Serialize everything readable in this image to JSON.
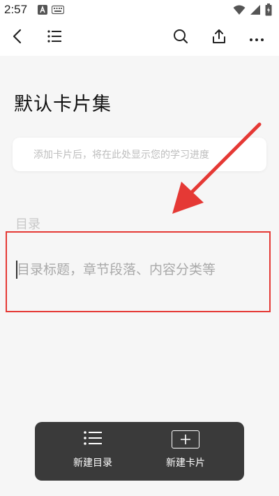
{
  "status_bar": {
    "time": "2:57",
    "icons_left": [
      "a-notification-icon",
      "keyboard-icon"
    ],
    "icons_right": [
      "wifi-icon",
      "signal-icon",
      "battery-icon"
    ]
  },
  "toolbar": {
    "icons": [
      "back-icon",
      "list-icon",
      "search-icon",
      "share-icon",
      "more-icon"
    ]
  },
  "page": {
    "title": "默认卡片集",
    "progress_placeholder": "添加卡片后，将在此处显示您的学习进度",
    "toc_label": "目录",
    "toc_input_placeholder": "目录标题，章节段落、内容分类等",
    "toc_input_value": ""
  },
  "annotation": {
    "highlight_color": "#e53935"
  },
  "bottom_bar": {
    "new_toc_label": "新建目录",
    "new_card_label": "新建卡片"
  }
}
